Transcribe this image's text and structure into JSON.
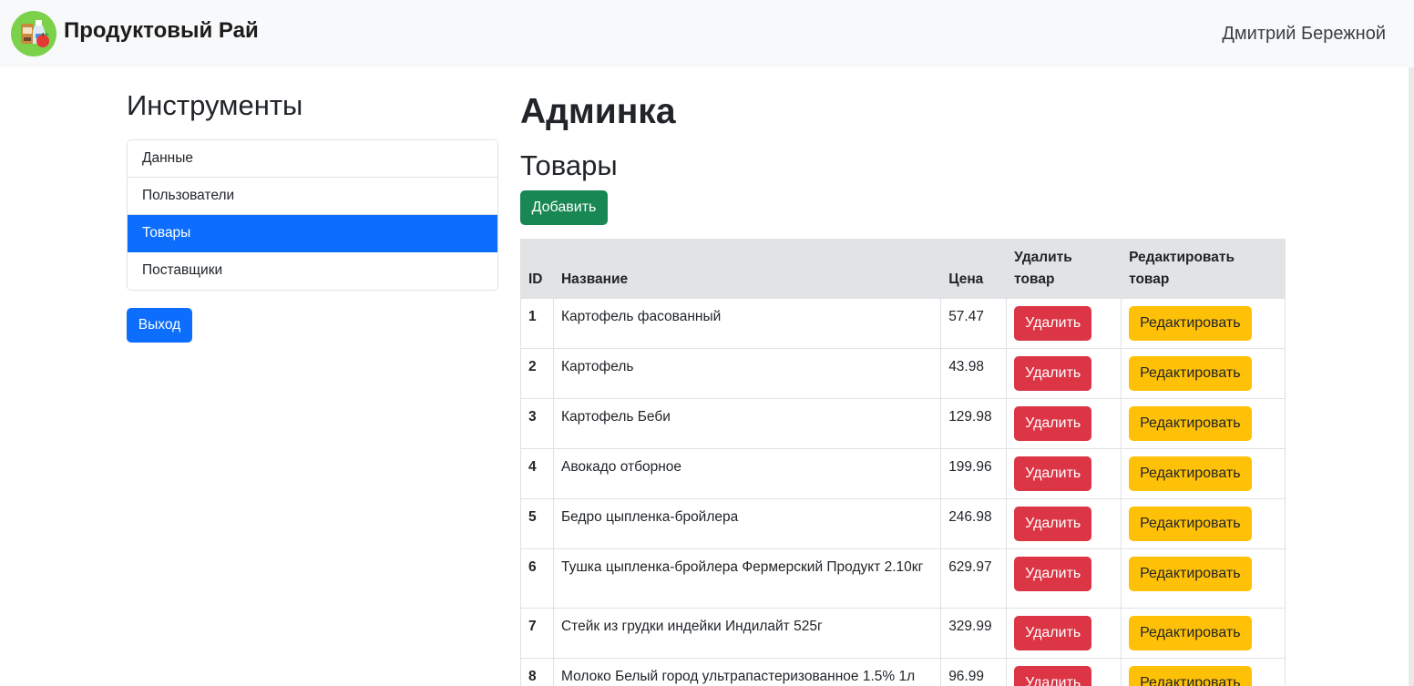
{
  "navbar": {
    "brand": "Продуктовый Рай",
    "logo_icon": "grocery-logo-icon",
    "user": "Дмитрий Бережной"
  },
  "sidebar": {
    "title": "Инструменты",
    "items": [
      {
        "label": "Данные",
        "active": false
      },
      {
        "label": "Пользователи",
        "active": false
      },
      {
        "label": "Товары",
        "active": true
      },
      {
        "label": "Поставщики",
        "active": false
      }
    ],
    "logout_label": "Выход"
  },
  "main": {
    "title": "Админка",
    "section_title": "Товары",
    "add_label": "Добавить",
    "table": {
      "columns": [
        "ID",
        "Название",
        "Цена",
        "Удалить товар",
        "Редактировать товар"
      ],
      "rows": [
        {
          "id": "1",
          "name": "Картофель фасованный",
          "price": "57.47"
        },
        {
          "id": "2",
          "name": "Картофель",
          "price": "43.98"
        },
        {
          "id": "3",
          "name": "Картофель Беби",
          "price": "129.98"
        },
        {
          "id": "4",
          "name": "Авокадо отборное",
          "price": "199.96"
        },
        {
          "id": "5",
          "name": "Бедро цыпленка-бройлера",
          "price": "246.98"
        },
        {
          "id": "6",
          "name": "Тушка цыпленка-бройлера Фермерский Продукт 2.10кг",
          "price": "629.97"
        },
        {
          "id": "7",
          "name": "Стейк из грудки индейки Индилайт 525г",
          "price": "329.99"
        },
        {
          "id": "8",
          "name": "Молоко Белый город ультрапастеризованное 1.5% 1л",
          "price": "96.99"
        }
      ],
      "delete_label": "Удалить",
      "edit_label": "Редактировать"
    }
  },
  "colors": {
    "primary": "#0d6efd",
    "success": "#198754",
    "danger": "#dc3545",
    "warning": "#ffc107",
    "navbar_bg": "#f8f9fa"
  }
}
